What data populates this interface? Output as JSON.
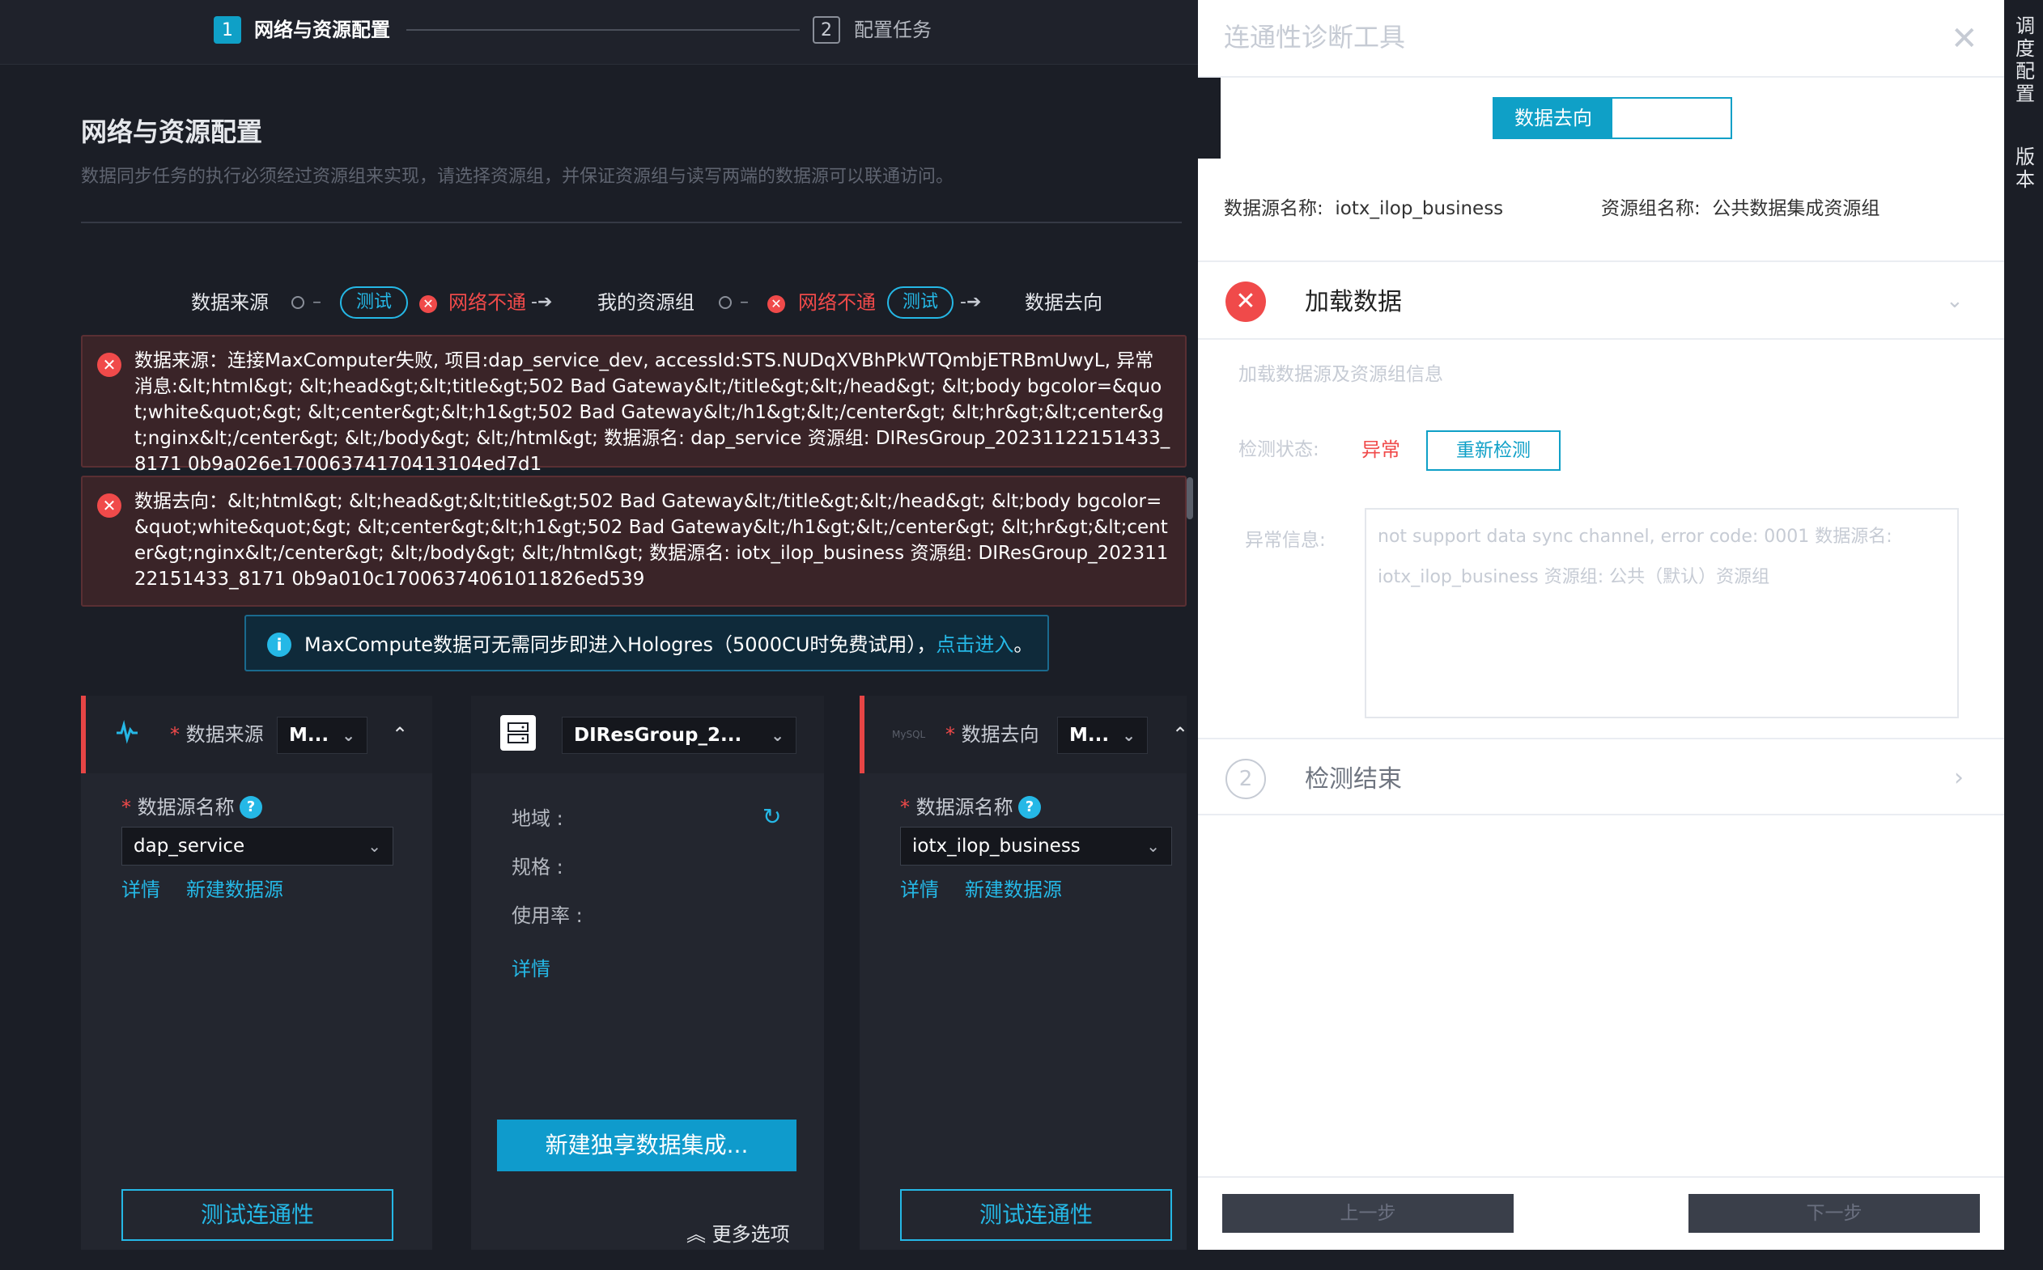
{
  "steps": {
    "step1": {
      "num": "1",
      "label": "网络与资源配置"
    },
    "step2": {
      "num": "2",
      "label": "配置任务"
    }
  },
  "page": {
    "title": "网络与资源配置",
    "description": "数据同步任务的执行必须经过资源组来实现，请选择资源组，并保证资源组与读写两端的数据源可以联通访问。"
  },
  "flow": {
    "source_label": "数据来源",
    "test_label": "测试",
    "net_fail_label": "网络不通",
    "resource_label": "我的资源组",
    "target_label": "数据去向",
    "dot_dash": "○ –",
    "arrow": "-➔"
  },
  "errors": {
    "source": "数据来源：连接MaxComputer失败, 项目:dap_service_dev, accessId:STS.NUDqXVBhPkWTQmbjETRBmUwyL, 异常消息:&lt;html&gt; &lt;head&gt;&lt;title&gt;502 Bad Gateway&lt;/title&gt;&lt;/head&gt; &lt;body bgcolor=&quot;white&quot;&gt; &lt;center&gt;&lt;h1&gt;502 Bad Gateway&lt;/h1&gt;&lt;/center&gt; &lt;hr&gt;&lt;center&gt;nginx&lt;/center&gt; &lt;/body&gt; &lt;/html&gt; 数据源名: dap_service 资源组: DIResGroup_20231122151433_8171 0b9a026e17006374170413104ed7d1",
    "target": "数据去向：&lt;html&gt; &lt;head&gt;&lt;title&gt;502 Bad Gateway&lt;/title&gt;&lt;/head&gt; &lt;body bgcolor=&quot;white&quot;&gt; &lt;center&gt;&lt;h1&gt;502 Bad Gateway&lt;/h1&gt;&lt;/center&gt; &lt;hr&gt;&lt;center&gt;nginx&lt;/center&gt; &lt;/body&gt; &lt;/html&gt; 数据源名: iotx_ilop_business 资源组: DIResGroup_20231122151433_8171 0b9a010c17006374061011826ed539"
  },
  "info_banner": {
    "text": "MaxCompute数据可无需同步即进入Hologres（5000CU时免费试用），",
    "link": "点击进入",
    "tail": "。"
  },
  "source_panel": {
    "header_label": "数据来源",
    "type_value": "M...",
    "field_label": "数据源名称",
    "field_value": "dap_service",
    "link_detail": "详情",
    "link_new": "新建数据源",
    "test_button": "测试连通性"
  },
  "resource_panel": {
    "group_value": "DIResGroup_2...",
    "region_label": "地域 :",
    "spec_label": "规格 :",
    "usage_label": "使用率 :",
    "detail_link": "详情",
    "create_button": "新建独享数据集成...",
    "more_options": "更多选项"
  },
  "target_panel": {
    "header_label": "数据去向",
    "type_value": "M...",
    "field_label": "数据源名称",
    "field_value": "iotx_ilop_business",
    "link_detail": "详情",
    "link_new": "新建数据源",
    "test_button": "测试连通性"
  },
  "drawer": {
    "title": "连通性诊断工具",
    "segment_active": "数据去向",
    "datasource_label": "数据源名称:",
    "datasource_value": "iotx_ilop_business",
    "resgroup_label": "资源组名称:",
    "resgroup_value": "公共数据集成资源组",
    "load_title": "加载数据",
    "load_subtitle": "加载数据源及资源组信息",
    "status_label": "检测状态:",
    "status_value": "异常",
    "recheck_button": "重新检测",
    "errinfo_label": "异常信息:",
    "errinfo_line1": "not support data sync channel, error code: 0001 数据源名:",
    "errinfo_line2": "iotx_ilop_business 资源组: 公共（默认）资源组",
    "end_num": "2",
    "end_title": "检测结束",
    "prev_button": "上一步",
    "next_button": "下一步"
  },
  "side_strip": {
    "item1": "调度配置",
    "item2": "版本"
  },
  "colors": {
    "accent": "#25b8e6",
    "error": "#f04a4a",
    "bg_dark": "#1b1e26",
    "drawer_bg": "#ffffff"
  }
}
